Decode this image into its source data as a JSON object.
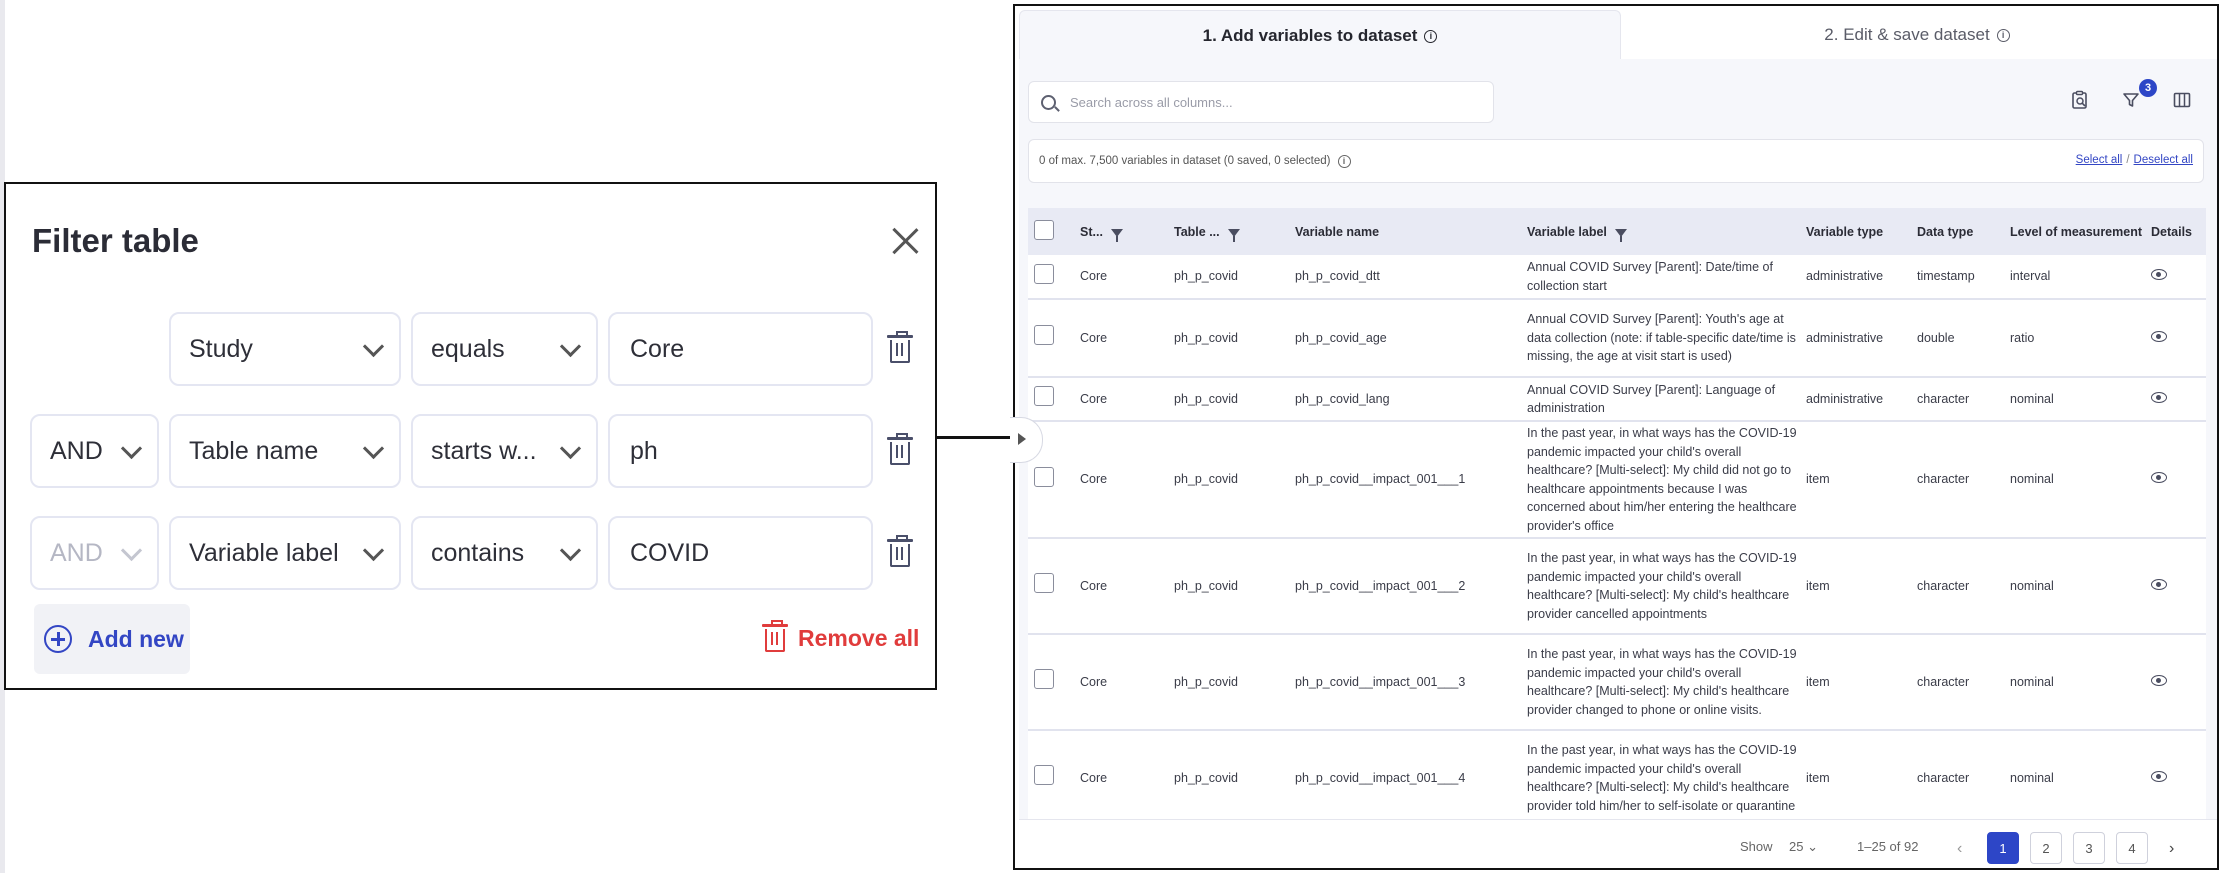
{
  "filter": {
    "title": "Filter table",
    "rows": [
      {
        "connector": "",
        "field": "Study",
        "operator": "equals",
        "value": "Core"
      },
      {
        "connector": "AND",
        "field": "Table name",
        "operator": "starts w...",
        "value": "ph"
      },
      {
        "connector": "AND",
        "field": "Variable label",
        "operator": "contains",
        "value": "COVID"
      }
    ],
    "add_new": "Add new",
    "remove_all": "Remove all"
  },
  "tabs": [
    {
      "label": "1. Add variables to dataset"
    },
    {
      "label": "2. Edit & save dataset"
    }
  ],
  "search": {
    "placeholder": "Search across all columns..."
  },
  "toolbar": {
    "filter_badge": "3"
  },
  "dataset_count": {
    "text": "0 of max. 7,500 variables in dataset (0 saved, 0 selected)",
    "select_all": "Select all",
    "separator": "/",
    "deselect_all": "Deselect all"
  },
  "table": {
    "headers": [
      "St...",
      "Table ...",
      "Variable name",
      "Variable label",
      "Variable type",
      "Data type",
      "Level of measurement",
      "Details"
    ],
    "rows": [
      [
        "Core",
        "ph_p_covid",
        "ph_p_covid_dtt",
        "Annual COVID Survey [Parent]: Date/time of collection start",
        "administrative",
        "timestamp",
        "interval"
      ],
      [
        "Core",
        "ph_p_covid",
        "ph_p_covid_age",
        "Annual COVID Survey [Parent]: Youth's age at data collection (note: if table-specific date/time is missing, the age at visit start is used)",
        "administrative",
        "double",
        "ratio"
      ],
      [
        "Core",
        "ph_p_covid",
        "ph_p_covid_lang",
        "Annual COVID Survey [Parent]: Language of administration",
        "administrative",
        "character",
        "nominal"
      ],
      [
        "Core",
        "ph_p_covid",
        "ph_p_covid__impact_001___1",
        "In the past year, in what ways has the COVID-19 pandemic impacted your child's overall healthcare? [Multi-select]: My child did not go to healthcare appointments because I was concerned about him/her entering the healthcare provider's office",
        "item",
        "character",
        "nominal"
      ],
      [
        "Core",
        "ph_p_covid",
        "ph_p_covid__impact_001___2",
        "In the past year, in what ways has the COVID-19 pandemic impacted your child's overall healthcare? [Multi-select]: My child's healthcare provider cancelled appointments",
        "item",
        "character",
        "nominal"
      ],
      [
        "Core",
        "ph_p_covid",
        "ph_p_covid__impact_001___3",
        "In the past year, in what ways has the COVID-19 pandemic impacted your child's overall healthcare? [Multi-select]: My child's healthcare provider changed to phone or online visits.",
        "item",
        "character",
        "nominal"
      ],
      [
        "Core",
        "ph_p_covid",
        "ph_p_covid__impact_001___4",
        "In the past year, in what ways has the COVID-19 pandemic impacted your child's overall healthcare? [Multi-select]: My child's healthcare provider told him/her to self-isolate or quarantine",
        "item",
        "character",
        "nominal"
      ]
    ]
  },
  "footer": {
    "show_label": "Show",
    "page_size": "25",
    "range": "1–25 of 92",
    "pages": [
      "1",
      "2",
      "3",
      "4"
    ],
    "current_page": "1"
  },
  "colors": {
    "accent": "#2d46c7",
    "danger": "#e03c3c"
  },
  "icons": [
    "close-icon",
    "chevron-down-icon",
    "trash-icon",
    "plus-circle-icon",
    "search-icon",
    "info-icon",
    "clipboard-search-icon",
    "filter-icon",
    "columns-icon",
    "eye-icon"
  ]
}
